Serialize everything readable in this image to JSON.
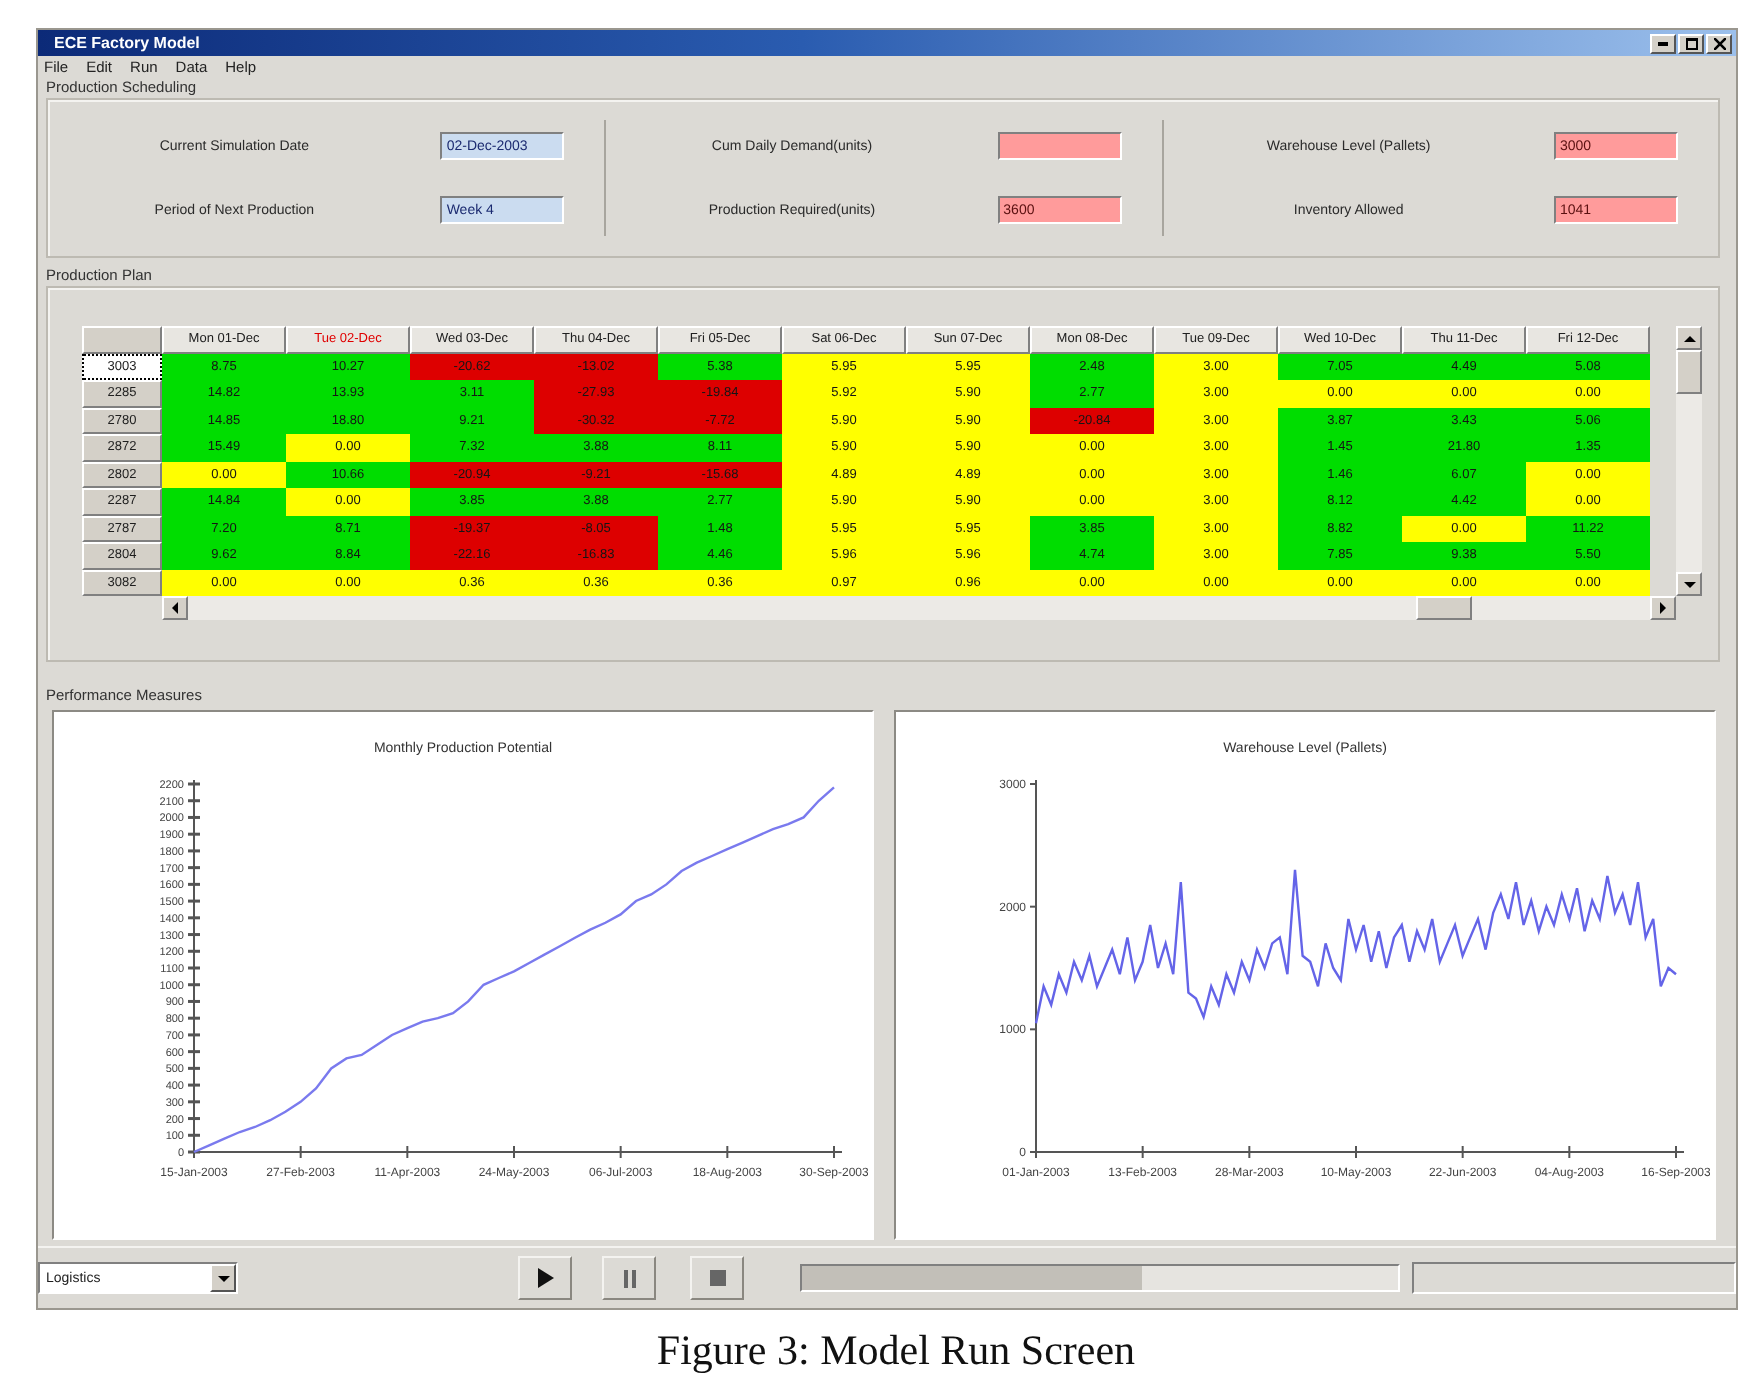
{
  "window": {
    "title": "ECE Factory Model"
  },
  "menu": [
    "File",
    "Edit",
    "Run",
    "Data",
    "Help"
  ],
  "scheduling": {
    "label": "Production Scheduling",
    "groups": [
      {
        "fields": [
          {
            "label": "Current Simulation Date",
            "value": "02-Dec-2003",
            "alert": false
          },
          {
            "label": "Period of Next Production",
            "value": "Week 4",
            "alert": false
          }
        ]
      },
      {
        "fields": [
          {
            "label": "Cum Daily Demand(units)",
            "alert": true
          },
          {
            "label": "Production Required(units)",
            "value": "3600",
            "alert": true
          }
        ]
      },
      {
        "fields": [
          {
            "label": "Warehouse Level (Pallets)",
            "value": "3000",
            "alert": true
          },
          {
            "label": "Inventory Allowed",
            "value": "1041",
            "alert": true
          }
        ]
      }
    ]
  },
  "plan": {
    "label": "Production Plan",
    "table": {
      "columns": [
        {
          "label": "Mon 01-Dec",
          "current": false
        },
        {
          "label": "Tue 02-Dec",
          "current": true
        },
        {
          "label": "Wed 03-Dec",
          "current": false
        },
        {
          "label": "Thu 04-Dec",
          "current": false
        },
        {
          "label": "Fri 05-Dec",
          "current": false
        },
        {
          "label": "Sat 06-Dec",
          "current": false
        },
        {
          "label": "Sun 07-Dec",
          "current": false
        },
        {
          "label": "Mon 08-Dec",
          "current": false
        },
        {
          "label": "Tue 09-Dec",
          "current": false
        },
        {
          "label": "Wed 10-Dec",
          "current": false
        },
        {
          "label": "Thu 11-Dec",
          "current": false
        },
        {
          "label": "Fri 12-Dec",
          "current": false
        }
      ],
      "rows": [
        {
          "label": "3003",
          "selected": true,
          "cells": [
            {
              "text": "8.75",
              "color": "#00dd00"
            },
            {
              "text": "10.27",
              "color": "#00dd00"
            },
            {
              "text": "-20.62",
              "color": "#dd0000"
            },
            {
              "text": "-13.02",
              "color": "#dd0000"
            },
            {
              "text": "5.38",
              "color": "#00dd00"
            },
            {
              "text": "5.95",
              "color": "#ffff00"
            },
            {
              "text": "5.95",
              "color": "#ffff00"
            },
            {
              "text": "2.48",
              "color": "#00dd00"
            },
            {
              "text": "3.00",
              "color": "#ffff00"
            },
            {
              "text": "7.05",
              "color": "#00dd00"
            },
            {
              "text": "4.49",
              "color": "#00dd00"
            },
            {
              "text": "5.08",
              "color": "#00dd00"
            }
          ]
        },
        {
          "label": "2285",
          "selected": false,
          "cells": [
            {
              "text": "14.82",
              "color": "#00dd00"
            },
            {
              "text": "13.93",
              "color": "#00dd00"
            },
            {
              "text": "3.11",
              "color": "#00dd00"
            },
            {
              "text": "-27.93",
              "color": "#dd0000"
            },
            {
              "text": "-19.84",
              "color": "#dd0000"
            },
            {
              "text": "5.92",
              "color": "#ffff00"
            },
            {
              "text": "5.90",
              "color": "#ffff00"
            },
            {
              "text": "2.77",
              "color": "#00dd00"
            },
            {
              "text": "3.00",
              "color": "#ffff00"
            },
            {
              "text": "0.00",
              "color": "#ffff00"
            },
            {
              "text": "0.00",
              "color": "#ffff00"
            },
            {
              "text": "0.00",
              "color": "#ffff00"
            }
          ]
        },
        {
          "label": "2780",
          "selected": false,
          "cells": [
            {
              "text": "14.85",
              "color": "#00dd00"
            },
            {
              "text": "18.80",
              "color": "#00dd00"
            },
            {
              "text": "9.21",
              "color": "#00dd00"
            },
            {
              "text": "-30.32",
              "color": "#dd0000"
            },
            {
              "text": "-7.72",
              "color": "#dd0000"
            },
            {
              "text": "5.90",
              "color": "#ffff00"
            },
            {
              "text": "5.90",
              "color": "#ffff00"
            },
            {
              "text": "-20.84",
              "color": "#dd0000"
            },
            {
              "text": "3.00",
              "color": "#ffff00"
            },
            {
              "text": "3.87",
              "color": "#00dd00"
            },
            {
              "text": "3.43",
              "color": "#00dd00"
            },
            {
              "text": "5.06",
              "color": "#00dd00"
            }
          ]
        },
        {
          "label": "2872",
          "selected": false,
          "cells": [
            {
              "text": "15.49",
              "color": "#00dd00"
            },
            {
              "text": "0.00",
              "color": "#ffff00"
            },
            {
              "text": "7.32",
              "color": "#00dd00"
            },
            {
              "text": "3.88",
              "color": "#00dd00"
            },
            {
              "text": "8.11",
              "color": "#00dd00"
            },
            {
              "text": "5.90",
              "color": "#ffff00"
            },
            {
              "text": "5.90",
              "color": "#ffff00"
            },
            {
              "text": "0.00",
              "color": "#ffff00"
            },
            {
              "text": "3.00",
              "color": "#ffff00"
            },
            {
              "text": "1.45",
              "color": "#00dd00"
            },
            {
              "text": "21.80",
              "color": "#00dd00"
            },
            {
              "text": "1.35",
              "color": "#00dd00"
            }
          ]
        },
        {
          "label": "2802",
          "selected": false,
          "cells": [
            {
              "text": "0.00",
              "color": "#ffff00"
            },
            {
              "text": "10.66",
              "color": "#00dd00"
            },
            {
              "text": "-20.94",
              "color": "#dd0000"
            },
            {
              "text": "-9.21",
              "color": "#dd0000"
            },
            {
              "text": "-15.68",
              "color": "#dd0000"
            },
            {
              "text": "4.89",
              "color": "#ffff00"
            },
            {
              "text": "4.89",
              "color": "#ffff00"
            },
            {
              "text": "0.00",
              "color": "#ffff00"
            },
            {
              "text": "3.00",
              "color": "#ffff00"
            },
            {
              "text": "1.46",
              "color": "#00dd00"
            },
            {
              "text": "6.07",
              "color": "#00dd00"
            },
            {
              "text": "0.00",
              "color": "#ffff00"
            }
          ]
        },
        {
          "label": "2287",
          "selected": false,
          "cells": [
            {
              "text": "14.84",
              "color": "#00dd00"
            },
            {
              "text": "0.00",
              "color": "#ffff00"
            },
            {
              "text": "3.85",
              "color": "#00dd00"
            },
            {
              "text": "3.88",
              "color": "#00dd00"
            },
            {
              "text": "2.77",
              "color": "#00dd00"
            },
            {
              "text": "5.90",
              "color": "#ffff00"
            },
            {
              "text": "5.90",
              "color": "#ffff00"
            },
            {
              "text": "0.00",
              "color": "#ffff00"
            },
            {
              "text": "3.00",
              "color": "#ffff00"
            },
            {
              "text": "8.12",
              "color": "#00dd00"
            },
            {
              "text": "4.42",
              "color": "#00dd00"
            },
            {
              "text": "0.00",
              "color": "#ffff00"
            }
          ]
        },
        {
          "label": "2787",
          "selected": false,
          "cells": [
            {
              "text": "7.20",
              "color": "#00dd00"
            },
            {
              "text": "8.71",
              "color": "#00dd00"
            },
            {
              "text": "-19.37",
              "color": "#dd0000"
            },
            {
              "text": "-8.05",
              "color": "#dd0000"
            },
            {
              "text": "1.48",
              "color": "#00dd00"
            },
            {
              "text": "5.95",
              "color": "#ffff00"
            },
            {
              "text": "5.95",
              "color": "#ffff00"
            },
            {
              "text": "3.85",
              "color": "#00dd00"
            },
            {
              "text": "3.00",
              "color": "#ffff00"
            },
            {
              "text": "8.82",
              "color": "#00dd00"
            },
            {
              "text": "0.00",
              "color": "#ffff00"
            },
            {
              "text": "11.22",
              "color": "#00dd00"
            }
          ]
        },
        {
          "label": "2804",
          "selected": false,
          "cells": [
            {
              "text": "9.62",
              "color": "#00dd00"
            },
            {
              "text": "8.84",
              "color": "#00dd00"
            },
            {
              "text": "-22.16",
              "color": "#dd0000"
            },
            {
              "text": "-16.83",
              "color": "#dd0000"
            },
            {
              "text": "4.46",
              "color": "#00dd00"
            },
            {
              "text": "5.96",
              "color": "#ffff00"
            },
            {
              "text": "5.96",
              "color": "#ffff00"
            },
            {
              "text": "4.74",
              "color": "#00dd00"
            },
            {
              "text": "3.00",
              "color": "#ffff00"
            },
            {
              "text": "7.85",
              "color": "#00dd00"
            },
            {
              "text": "9.38",
              "color": "#00dd00"
            },
            {
              "text": "5.50",
              "color": "#00dd00"
            }
          ]
        },
        {
          "label": "3082",
          "selected": false,
          "cells": [
            {
              "text": "0.00",
              "color": "#ffff00"
            },
            {
              "text": "0.00",
              "color": "#ffff00"
            },
            {
              "text": "0.36",
              "color": "#ffff00"
            },
            {
              "text": "0.36",
              "color": "#ffff00"
            },
            {
              "text": "0.36",
              "color": "#ffff00"
            },
            {
              "text": "0.97",
              "color": "#ffff00"
            },
            {
              "text": "0.96",
              "color": "#ffff00"
            },
            {
              "text": "0.00",
              "color": "#ffff00"
            },
            {
              "text": "0.00",
              "color": "#ffff00"
            },
            {
              "text": "0.00",
              "color": "#ffff00"
            },
            {
              "text": "0.00",
              "color": "#ffff00"
            },
            {
              "text": "0.00",
              "color": "#ffff00"
            }
          ]
        }
      ]
    }
  },
  "performance": {
    "label": "Performance Measures",
    "charts": [
      {
        "chart_data": {
          "type": "line",
          "title": "Monthly Production Potential",
          "categories": [
            "15-Jan-2003",
            null,
            null,
            null,
            null,
            null,
            null,
            "27-Feb-2003",
            null,
            null,
            null,
            null,
            null,
            null,
            "11-Apr-2003",
            null,
            null,
            null,
            null,
            null,
            null,
            "24-May-2003",
            null,
            null,
            null,
            null,
            null,
            null,
            "06-Jul-2003",
            null,
            null,
            null,
            null,
            null,
            null,
            "18-Aug-2003",
            null,
            null,
            null,
            null,
            null,
            null,
            "30-Sep-2003"
          ],
          "series": [
            {
              "color": "#7a7aee",
              "values": [
                0,
                40,
                80,
                120,
                150,
                190,
                240,
                300,
                380,
                500,
                560,
                580,
                640,
                700,
                740,
                780,
                800,
                830,
                900,
                1000,
                1040,
                1080,
                1130,
                1180,
                1230,
                1280,
                1330,
                1370,
                1420,
                1500,
                1540,
                1600,
                1680,
                1730,
                1770,
                1810,
                1850,
                1890,
                1930,
                1960,
                2000,
                2100,
                2180
              ]
            }
          ],
          "ylim": [
            0,
            2200
          ],
          "yticks": [
            0,
            100,
            200,
            300,
            400,
            500,
            600,
            700,
            800,
            900,
            1000,
            1100,
            1200,
            1300,
            1400,
            1500,
            1600,
            1700,
            1800,
            1900,
            2000,
            2100,
            2200
          ]
        }
      },
      {
        "chart_data": {
          "type": "line",
          "title": "Warehouse Level (Pallets)",
          "categories": [
            "01-Jan-2003",
            null,
            null,
            null,
            null,
            null,
            null,
            null,
            null,
            null,
            null,
            null,
            null,
            null,
            "13-Feb-2003",
            null,
            null,
            null,
            null,
            null,
            null,
            null,
            null,
            null,
            null,
            null,
            null,
            null,
            "28-Mar-2003",
            null,
            null,
            null,
            null,
            null,
            null,
            null,
            null,
            null,
            null,
            null,
            null,
            null,
            "10-May-2003",
            null,
            null,
            null,
            null,
            null,
            null,
            null,
            null,
            null,
            null,
            null,
            null,
            null,
            "22-Jun-2003",
            null,
            null,
            null,
            null,
            null,
            null,
            null,
            null,
            null,
            null,
            null,
            null,
            null,
            "04-Aug-2003",
            null,
            null,
            null,
            null,
            null,
            null,
            null,
            null,
            null,
            null,
            null,
            null,
            null,
            "16-Sep-2003"
          ],
          "series": [
            {
              "color": "#6464e8",
              "values": [
                1050,
                1350,
                1200,
                1450,
                1300,
                1550,
                1400,
                1600,
                1350,
                1500,
                1650,
                1450,
                1750,
                1400,
                1550,
                1850,
                1500,
                1700,
                1450,
                2200,
                1300,
                1250,
                1100,
                1350,
                1200,
                1450,
                1300,
                1550,
                1400,
                1650,
                1500,
                1700,
                1750,
                1450,
                2300,
                1600,
                1550,
                1350,
                1700,
                1500,
                1400,
                1900,
                1650,
                1850,
                1550,
                1800,
                1500,
                1750,
                1850,
                1550,
                1800,
                1650,
                1900,
                1550,
                1700,
                1850,
                1600,
                1750,
                1900,
                1650,
                1950,
                2100,
                1900,
                2200,
                1850,
                2050,
                1800,
                2000,
                1850,
                2100,
                1900,
                2150,
                1800,
                2050,
                1900,
                2250,
                1950,
                2100,
                1850,
                2200,
                1750,
                1900,
                1350,
                1500,
                1450
              ]
            }
          ],
          "ylim": [
            0,
            3000
          ],
          "yticks": [
            0,
            1000,
            2000,
            3000
          ]
        }
      }
    ]
  },
  "toolbar": {
    "view_dropdown": {
      "value": "Logistics"
    },
    "progress": {
      "level": 0.57
    }
  },
  "caption": "Figure 3: Model Run Screen"
}
